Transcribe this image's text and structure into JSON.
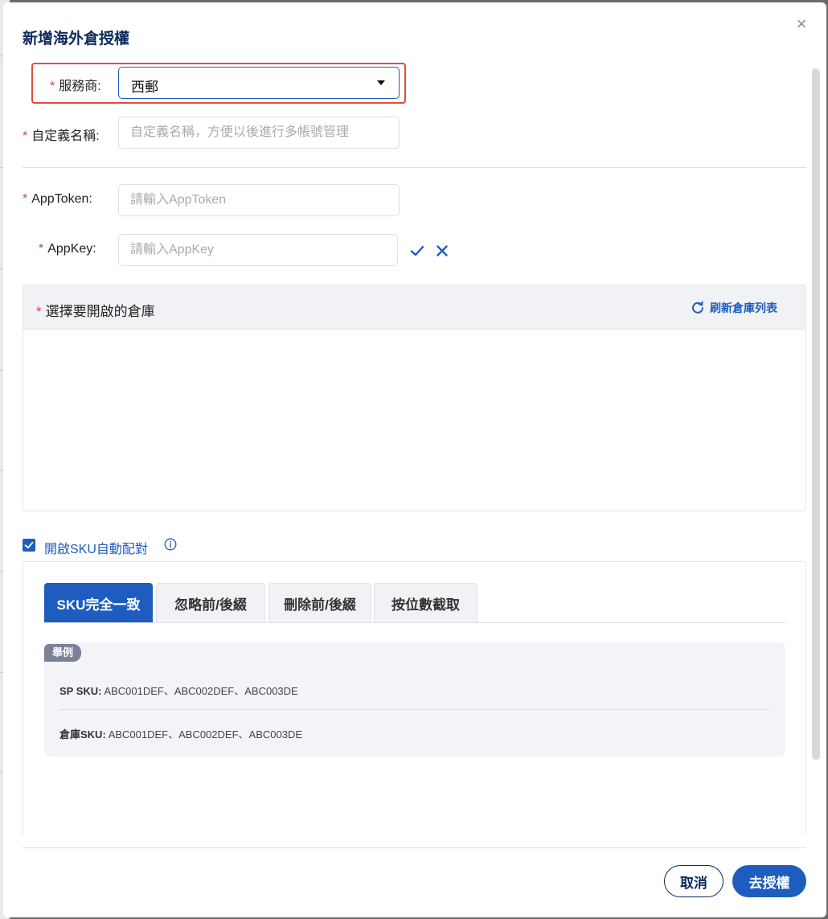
{
  "modal": {
    "title": "新增海外倉授權",
    "close_glyph": "×"
  },
  "form": {
    "provider": {
      "required_mark": "*",
      "label": "服務商:",
      "value": "西郵"
    },
    "custom_name": {
      "required_mark": "*",
      "label": "自定義名稱:",
      "placeholder": "自定義名稱，方便以後進行多帳號管理",
      "value": ""
    },
    "app_token": {
      "required_mark": "*",
      "label": "AppToken:",
      "placeholder": "請輸入AppToken",
      "value": ""
    },
    "app_key": {
      "required_mark": "*",
      "label": "AppKey:",
      "placeholder": "請輸入AppKey",
      "value": ""
    }
  },
  "warehouse": {
    "required_mark": "*",
    "title": "選擇要開啟的倉庫",
    "refresh_label": "刷新倉庫列表",
    "items": []
  },
  "sku_auto_match": {
    "checked": true,
    "label": "開啟SKU自動配對"
  },
  "sku_tabs": [
    {
      "label": "SKU完全一致",
      "active": true
    },
    {
      "label": "忽略前/後綴",
      "active": false
    },
    {
      "label": "刪除前/後綴",
      "active": false
    },
    {
      "label": "按位數截取",
      "active": false
    }
  ],
  "example": {
    "badge": "舉例",
    "sp_sku_label": "SP SKU:",
    "sp_sku_value": "ABC001DEF、ABC002DEF、ABC003DE",
    "wh_sku_label": "倉庫SKU:",
    "wh_sku_value": "ABC001DEF、ABC002DEF、ABC003DE"
  },
  "footer": {
    "cancel_label": "取消",
    "submit_label": "去授權"
  },
  "colors": {
    "primary": "#1e5dbf",
    "title": "#0c2a5c",
    "required": "#e23c3c",
    "highlight": "#e14d3f"
  }
}
